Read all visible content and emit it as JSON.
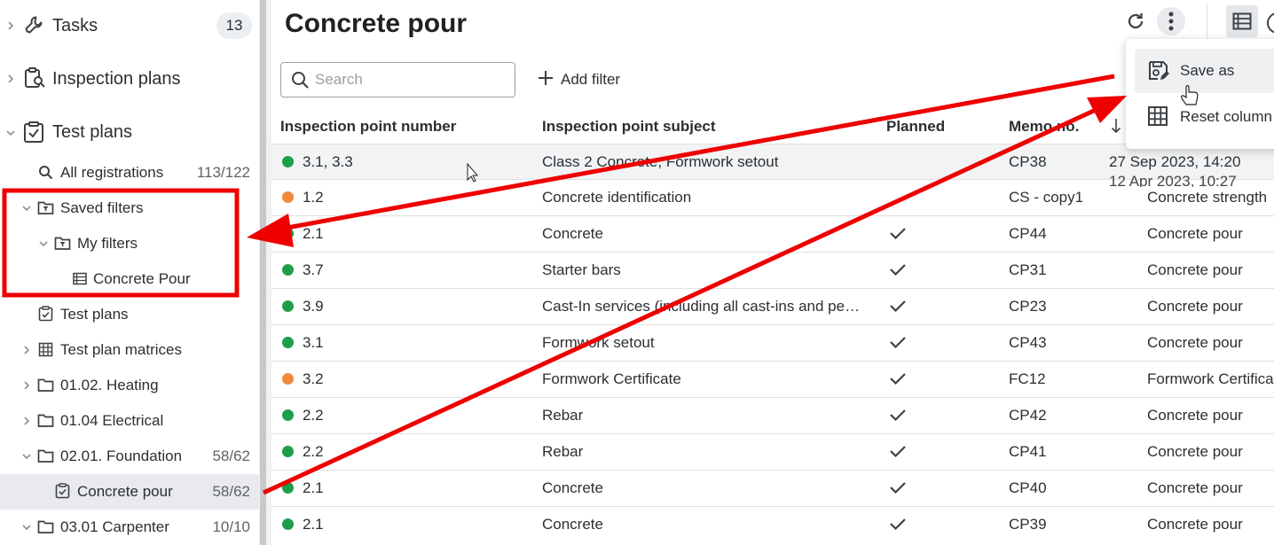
{
  "sidebar": {
    "tasks": {
      "label": "Tasks",
      "count": "13"
    },
    "inspection_plans": {
      "label": "Inspection plans"
    },
    "test_plans": {
      "label": "Test plans",
      "children": [
        {
          "label": "All registrations",
          "count": "113/122"
        },
        {
          "label": "Saved filters"
        },
        {
          "label": "My filters"
        },
        {
          "label": "Concrete Pour"
        },
        {
          "label": "Test plans"
        },
        {
          "label": "Test plan matrices"
        },
        {
          "label": "01.02. Heating"
        },
        {
          "label": "01.04 Electrical"
        },
        {
          "label": "02.01. Foundation",
          "count": "58/62"
        },
        {
          "label": "Concrete pour",
          "count": "58/62"
        },
        {
          "label": "03.01 Carpenter",
          "count": "10/10"
        }
      ]
    }
  },
  "main": {
    "title": "Concrete pour",
    "search_placeholder": "Search",
    "add_filter_label": "Add filter",
    "columns": [
      "Inspection point number",
      "Inspection point subject",
      "Planned",
      "Memo no."
    ],
    "rows": [
      {
        "number": "3.1, 3.3",
        "subject": "Class 2 Concrete, Formwork setout",
        "planned": false,
        "memo": "CP38",
        "date": "27 Sep 2023, 14:20",
        "status": "green"
      },
      {
        "number": "1.2",
        "subject": "Concrete identification",
        "planned": false,
        "memo": "CS - copy1",
        "date": "12 Apr 2023, 10:27",
        "extra": "Concrete strength",
        "status": "orange"
      },
      {
        "number": "2.1",
        "subject": "Concrete",
        "planned": true,
        "memo": "CP44",
        "extra": "Concrete pour",
        "status": "green"
      },
      {
        "number": "3.7",
        "subject": "Starter bars",
        "planned": true,
        "memo": "CP31",
        "extra": "Concrete pour",
        "status": "green"
      },
      {
        "number": "3.9",
        "subject": "Cast-In services (including all cast-ins and pe…",
        "planned": true,
        "memo": "CP23",
        "extra": "Concrete pour",
        "status": "green"
      },
      {
        "number": "3.1",
        "subject": "Formwork setout",
        "planned": true,
        "memo": "CP43",
        "extra": "Concrete pour",
        "status": "green"
      },
      {
        "number": "3.2",
        "subject": "Formwork Certificate",
        "planned": true,
        "memo": "FC12",
        "extra": "Formwork Certifica",
        "status": "orange"
      },
      {
        "number": "2.2",
        "subject": "Rebar",
        "planned": true,
        "memo": "CP42",
        "extra": "Concrete pour",
        "status": "green"
      },
      {
        "number": "2.2",
        "subject": "Rebar",
        "planned": true,
        "memo": "CP41",
        "extra": "Concrete pour",
        "status": "green"
      },
      {
        "number": "2.1",
        "subject": "Concrete",
        "planned": true,
        "memo": "CP40",
        "extra": "Concrete pour",
        "status": "green"
      },
      {
        "number": "2.1",
        "subject": "Concrete",
        "planned": true,
        "memo": "CP39",
        "extra": "Concrete pour",
        "status": "green"
      }
    ]
  },
  "menu": {
    "items": [
      {
        "label": "Save as",
        "icon": "save-as-icon"
      },
      {
        "label": "Reset column",
        "icon": "grid-icon"
      }
    ]
  },
  "colors": {
    "status_green": "#1e9e4a",
    "status_orange": "#f08a3c",
    "annotation_red": "#ee0000"
  }
}
